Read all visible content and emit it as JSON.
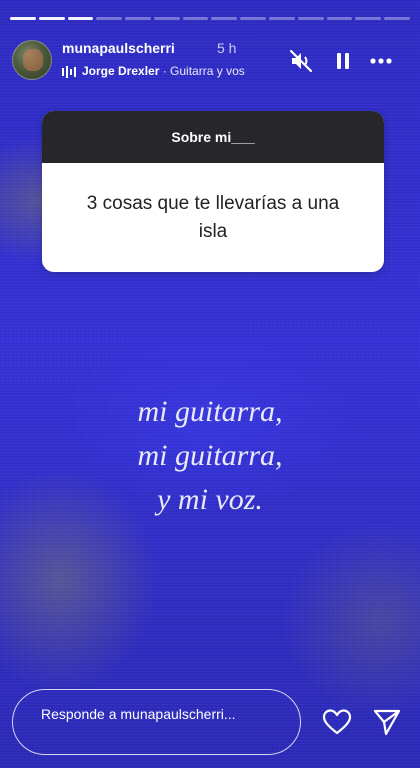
{
  "header": {
    "username": "munapaulscherri",
    "time_ago": "5 h",
    "music": {
      "artist": "Jorge Drexler",
      "separator": " · ",
      "song": "Guitarra y vos"
    }
  },
  "progress": {
    "segments_total": 14,
    "segments_viewed": 3
  },
  "question_box": {
    "title": "Sobre mi___",
    "question": "3 cosas que te llevarías a una isla"
  },
  "lyrics": [
    "mi guitarra,",
    "mi guitarra,",
    "y mi voz."
  ],
  "reply": {
    "placeholder": "Responde a munapaulscherri..."
  },
  "icons": {
    "mute": "speaker-muted-icon",
    "pause": "pause-icon",
    "more": "more-options-icon",
    "heart": "heart-icon",
    "send": "send-icon",
    "music": "music-bars-icon"
  },
  "colors": {
    "background": "#2f2dc9",
    "card_header": "#26262b",
    "lyrics": "#e9e9f7"
  }
}
